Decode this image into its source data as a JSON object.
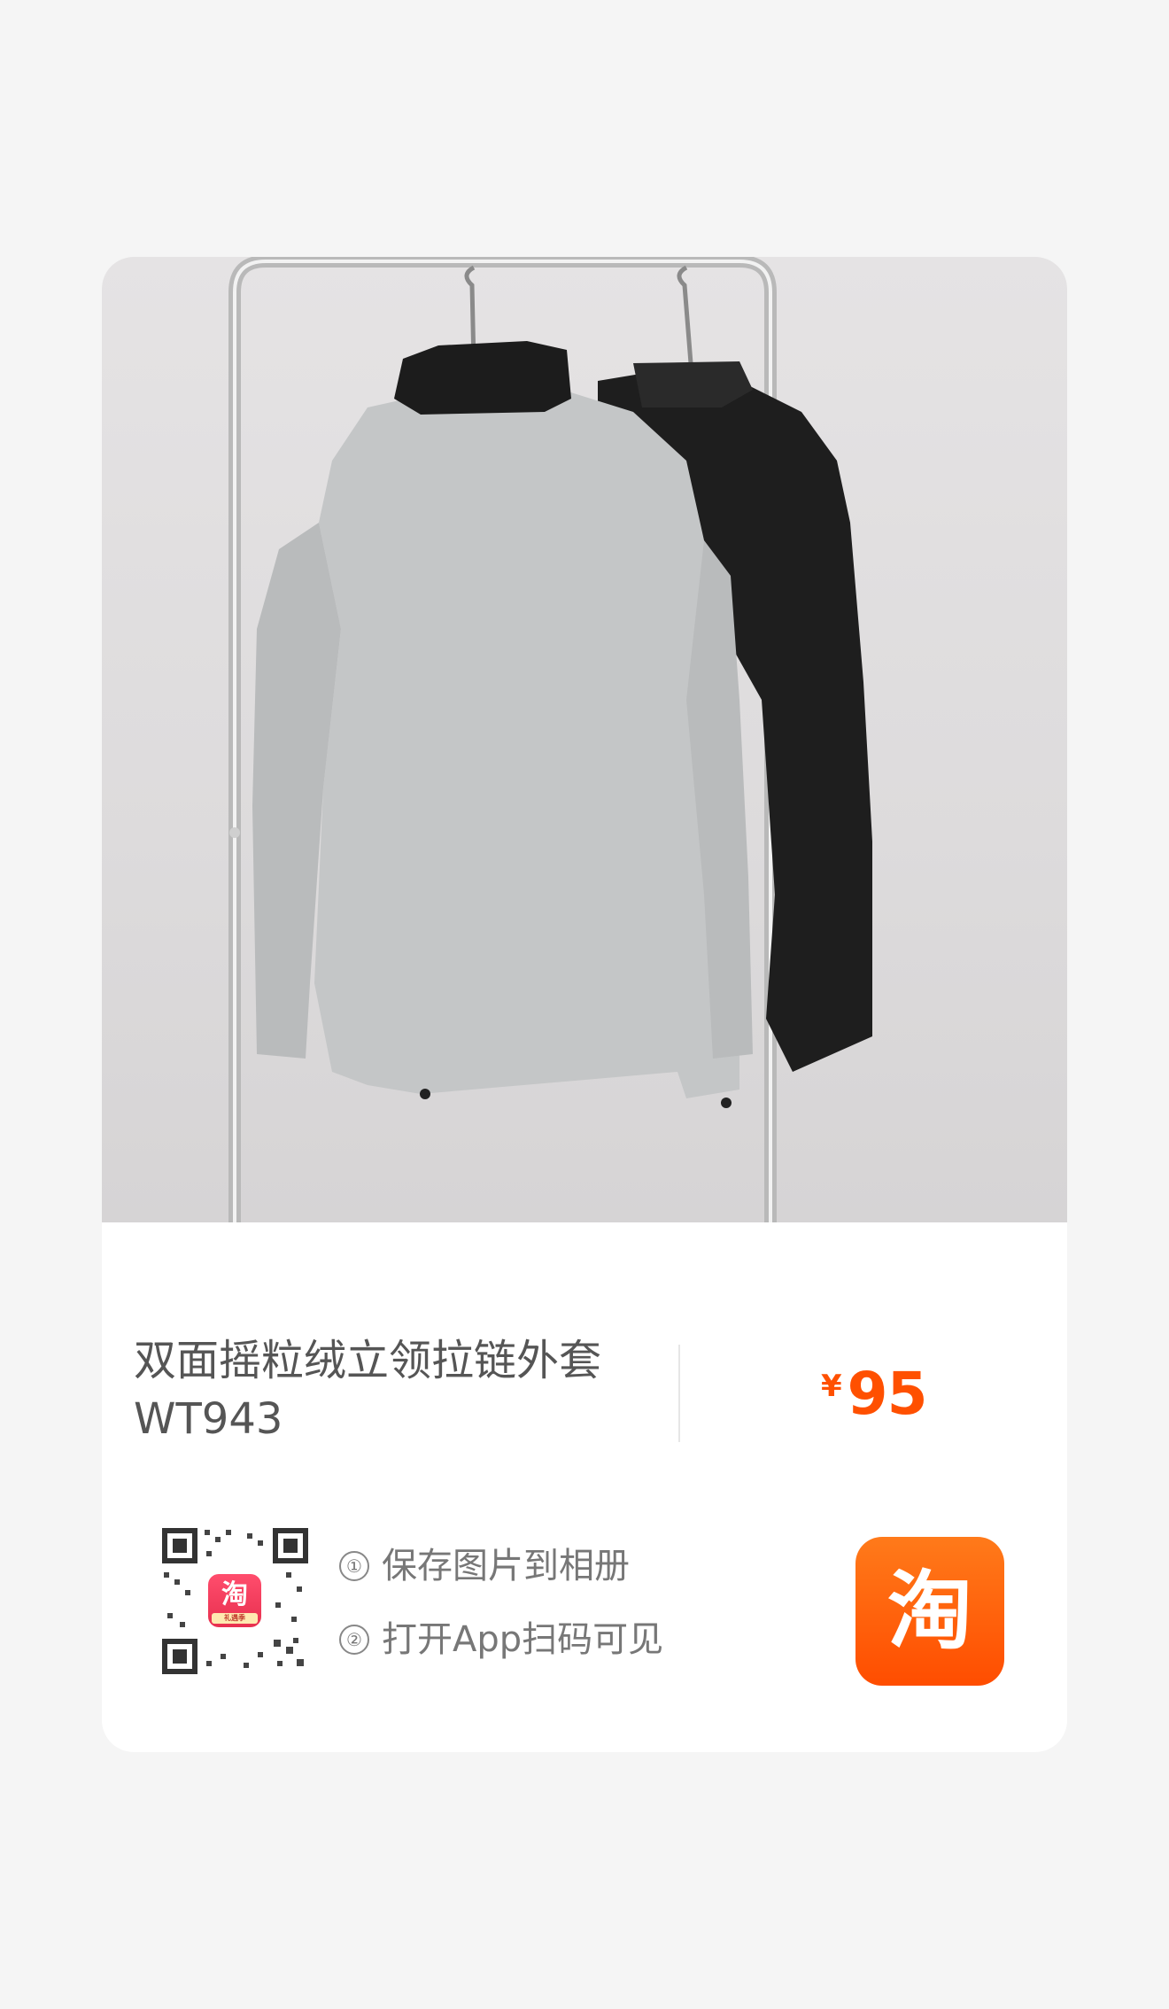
{
  "product": {
    "title_line1": "双面摇粒绒立领拉链外套",
    "title_line2": "WT943",
    "currency_symbol": "¥",
    "price": "95"
  },
  "share": {
    "step1_number": "①",
    "step1_text": "保存图片到相册",
    "step2_number": "②",
    "step2_text": "打开App扫码可见",
    "qr_badge_char": "淘",
    "qr_badge_sub": "礼遇季",
    "logo_char": "淘"
  },
  "colors": {
    "accent": "#ff5000",
    "logo_gradient_top": "#ff7a1a",
    "logo_gradient_bottom": "#ff4d00",
    "card_background": "#ffffff",
    "page_background": "#f5f5f5"
  },
  "icons": {
    "logo": "taobao-logo-icon",
    "qr": "qr-code"
  }
}
